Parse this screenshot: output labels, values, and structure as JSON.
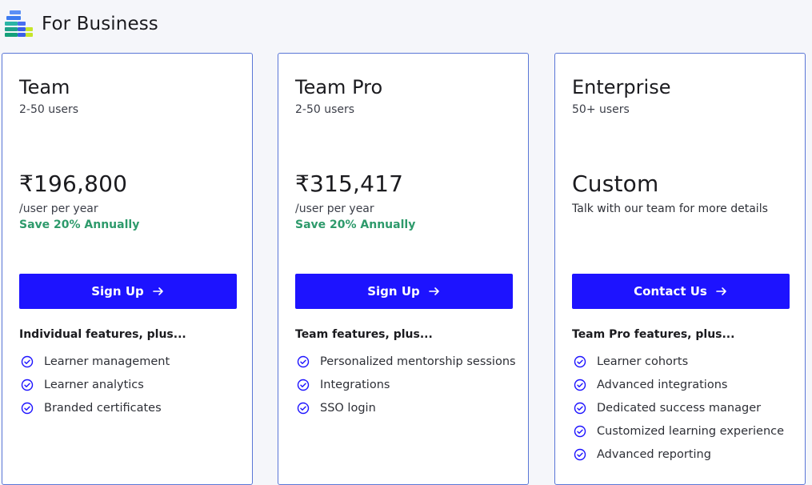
{
  "header": {
    "title": "For Business",
    "logo_icon": "for-business-logo"
  },
  "accent_color": "#1d13ff",
  "save_color": "#2d9a6b",
  "plans": [
    {
      "name": "Team",
      "users": "2-50 users",
      "price": "₹196,800",
      "price_unit": "/user per year",
      "save": "Save 20% Annually",
      "cta": "Sign Up",
      "features_title": "Individual features, plus...",
      "features": [
        "Learner management",
        "Learner analytics",
        "Branded certificates"
      ]
    },
    {
      "name": "Team Pro",
      "users": "2-50 users",
      "price": "₹315,417",
      "price_unit": "/user per year",
      "save": "Save 20% Annually",
      "cta": "Sign Up",
      "features_title": "Team features, plus...",
      "features": [
        "Personalized mentorship sessions",
        "Integrations",
        "SSO login"
      ]
    },
    {
      "name": "Enterprise",
      "users": "50+ users",
      "price": "Custom",
      "description": "Talk with our team for more details",
      "cta": "Contact Us",
      "features_title": "Team Pro features, plus...",
      "features": [
        "Learner cohorts",
        "Advanced integrations",
        "Dedicated success manager",
        "Customized learning experience",
        "Advanced reporting"
      ]
    }
  ]
}
